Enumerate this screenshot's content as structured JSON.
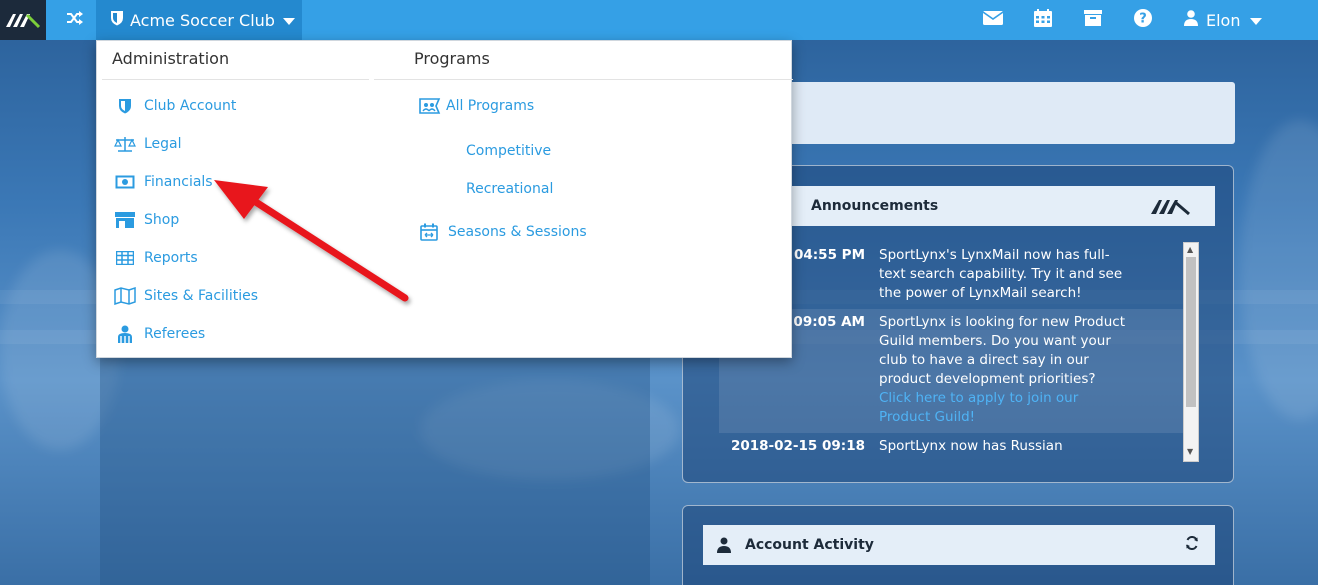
{
  "topbar": {
    "club_name": "Acme Soccer Club",
    "user_name": "Elon",
    "icons": [
      "mail-icon",
      "calendar-icon",
      "archive-icon",
      "help-icon",
      "user-icon"
    ]
  },
  "dropdown": {
    "administration": {
      "title": "Administration",
      "items": [
        {
          "label": "Club Account",
          "icon": "shield-icon"
        },
        {
          "label": "Legal",
          "icon": "scale-icon"
        },
        {
          "label": "Financials",
          "icon": "money-icon"
        },
        {
          "label": "Shop",
          "icon": "store-icon"
        },
        {
          "label": "Reports",
          "icon": "table-icon"
        },
        {
          "label": "Sites & Facilities",
          "icon": "map-icon"
        },
        {
          "label": "Referees",
          "icon": "referee-icon"
        }
      ]
    },
    "programs": {
      "title": "Programs",
      "all_programs": "All Programs",
      "competitive": "Competitive",
      "recreational": "Recreational",
      "seasons": "Seasons & Sessions"
    }
  },
  "announcements": {
    "title": "Announcements",
    "items": [
      {
        "date": "0 04:55 PM",
        "text": "SportLynx's LynxMail now has full-text search capability. Try it and see the power of LynxMail search!",
        "link": ""
      },
      {
        "date": "9 09:05 AM",
        "text": "SportLynx is looking for new Product Guild members. Do you want your club to have a direct say in our product development priorities?",
        "link": "Click here to apply to join our Product Guild!"
      },
      {
        "date": "2018-02-15 09:18 AM",
        "text": "SportLynx now has Russian",
        "link": ""
      }
    ]
  },
  "account_activity": {
    "title": "Account Activity"
  },
  "colors": {
    "topbar": "#35a0e6",
    "club_button": "#2489cf",
    "link": "#2b9be0",
    "arrow": "#e8141b"
  }
}
